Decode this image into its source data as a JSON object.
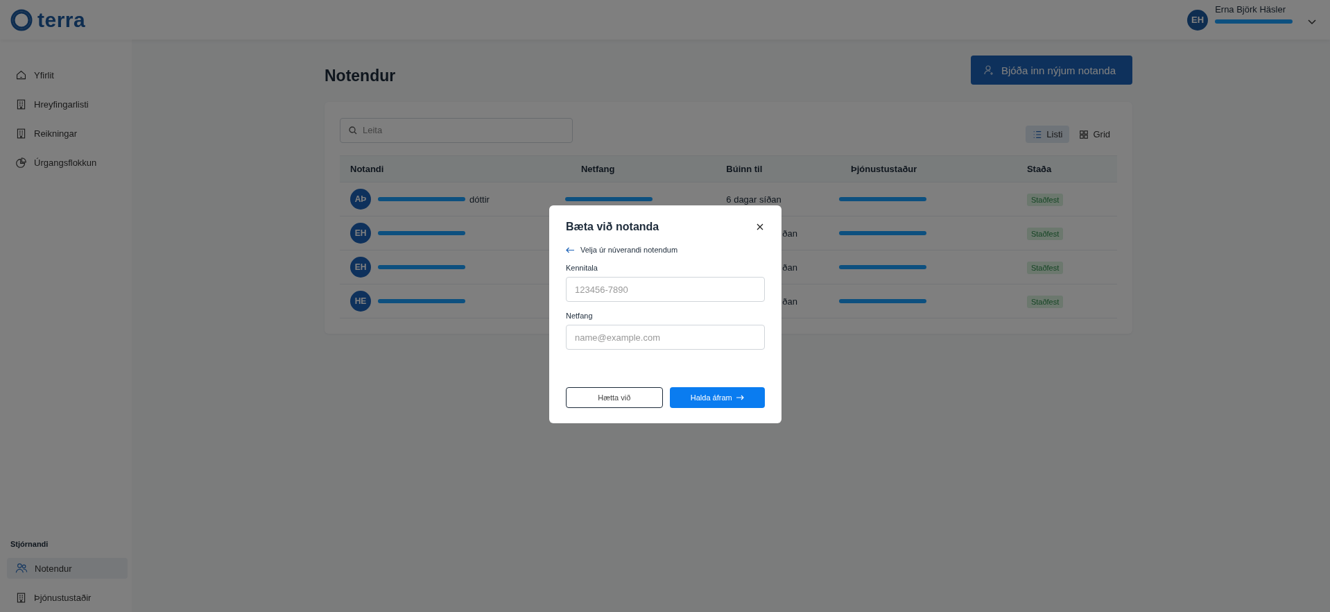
{
  "header": {
    "brand": "terra",
    "user": {
      "initials": "EH",
      "name": "Erna Björk Häsler",
      "redacted": true
    }
  },
  "sidebar": {
    "items": [
      {
        "label": "Yfirlit",
        "selected": false
      },
      {
        "label": "Hreyfingarlisti",
        "selected": false
      },
      {
        "label": "Reikningar",
        "selected": false
      },
      {
        "label": "Úrgangsflokkun",
        "selected": false
      }
    ],
    "section_title": "Stjórnandi",
    "admin_items": [
      {
        "label": "Notendur",
        "selected": true
      },
      {
        "label": "Þjónustustaðir",
        "selected": false
      }
    ]
  },
  "page": {
    "title": "Notendur",
    "invite_button": "Bjóða inn nýjum notanda"
  },
  "search": {
    "placeholder": "Leita"
  },
  "view_toggle": [
    {
      "label": "Listi",
      "selected": true
    },
    {
      "label": "Grid",
      "selected": false
    }
  ],
  "table": {
    "columns": [
      "Notandi",
      "Netfang",
      "Búinn til",
      "Þjónustustaður",
      "Staða"
    ],
    "rows": [
      {
        "initials": "AÞ",
        "name": "dóttir",
        "redacted": true,
        "created": "6 dagar síðan",
        "status": "Staðfest"
      },
      {
        "initials": "EH",
        "redacted": true,
        "created": "ðan",
        "status": "Staðfest"
      },
      {
        "initials": "EH",
        "redacted": true,
        "created": "ðan",
        "status": "Staðfest"
      },
      {
        "initials": "HE",
        "redacted": true,
        "created": "ðan",
        "status": "Staðfest"
      }
    ]
  },
  "dialog": {
    "title": "Bæta við notanda",
    "back_link": "Velja úr núverandi notendum",
    "fields": [
      {
        "label": "Kennitala",
        "placeholder": "123456-7890"
      },
      {
        "label": "Netfang",
        "placeholder": "name@example.com"
      }
    ],
    "cancel_button": "Hætta við",
    "continue_button": "Halda áfram"
  }
}
